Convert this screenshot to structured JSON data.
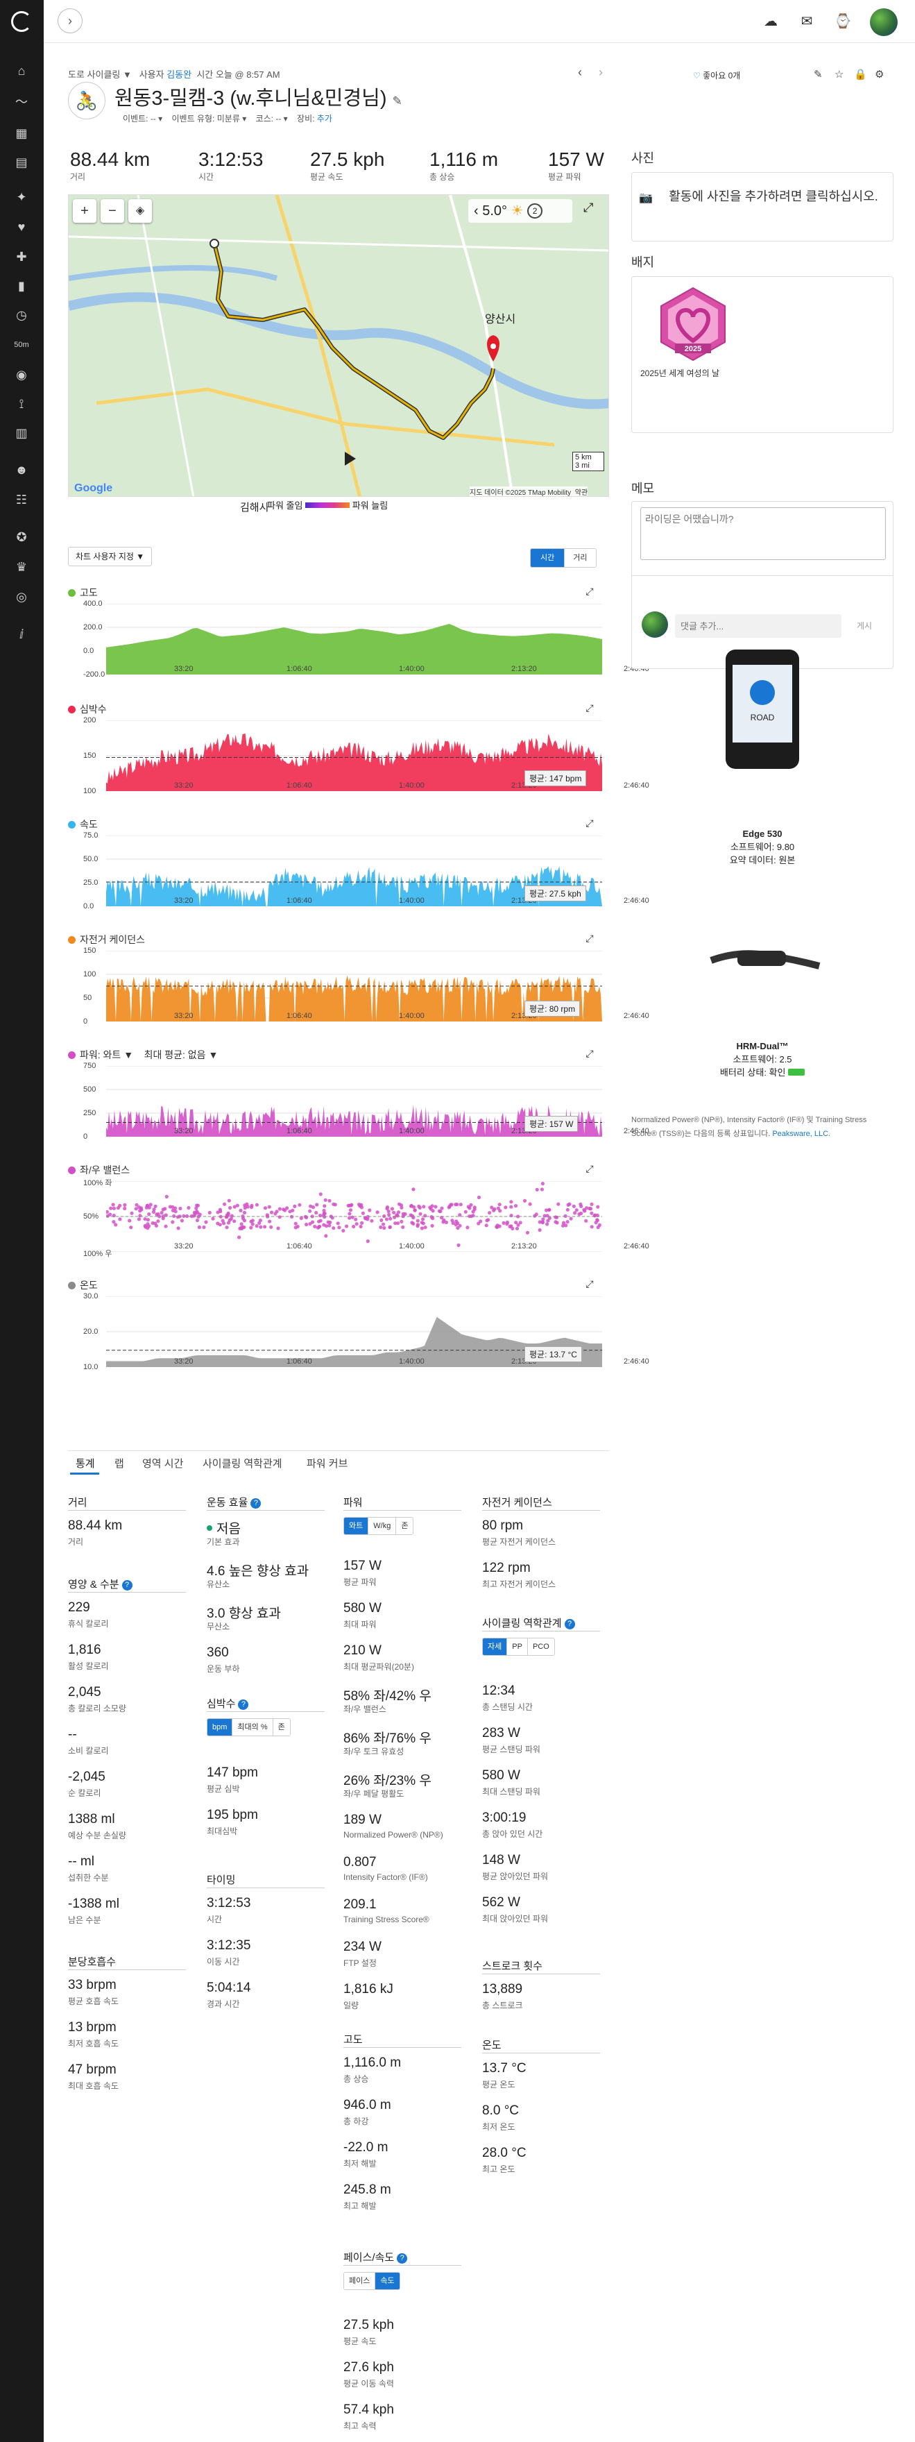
{
  "activity": {
    "type_label": "도로 사이클링 ▼",
    "user_prefix": "사용자",
    "user_name": "김동완",
    "time_info": "시간 오늘 @ 8:57 AM",
    "title": "원동3-밀캠-3 (w.후니님&민경님)",
    "event_label": "이벤트:",
    "event_value": "--",
    "event_type_label": "이벤트 유형:",
    "event_type_value": "미분류",
    "course_label": "코스:",
    "course_value": "--",
    "gear_label": "장비:",
    "gear_value": "추가",
    "likes": "좋아요 0개"
  },
  "summary": [
    {
      "value": "88.44 km",
      "label": "거리"
    },
    {
      "value": "3:12:53",
      "label": "시간"
    },
    {
      "value": "27.5 kph",
      "label": "평균 속도"
    },
    {
      "value": "1,116 m",
      "label": "총 상승"
    },
    {
      "value": "157 W",
      "label": "평균 파워"
    }
  ],
  "map": {
    "temp": "5.0°",
    "count": "2",
    "labels": {
      "yangsan": "양산시",
      "gimhae": "김해시"
    },
    "scale_km": "5 km",
    "scale_mi": "3 mi",
    "attribution": "지도 데이터 ©2025 TMap Mobility",
    "terms": "약관",
    "power_low": "파워 줄임",
    "power_high": "파워 늘림"
  },
  "chart_controls": {
    "custom": "차트 사용자 지정 ▼",
    "time": "시간",
    "distance": "거리"
  },
  "charts": {
    "elevation": {
      "title": "고도",
      "color": "#6cbf3a",
      "yticks": [
        "400.0",
        "200.0",
        "0.0",
        "-200.0"
      ],
      "values": [
        30,
        45,
        60,
        80,
        95,
        110,
        150,
        200,
        160,
        120,
        130,
        140,
        160,
        180,
        200,
        175,
        150,
        145,
        155,
        165,
        190,
        175,
        160,
        140,
        150,
        170,
        200,
        230,
        180,
        150,
        140,
        130,
        125,
        130,
        140,
        150,
        145,
        135,
        120,
        100
      ]
    },
    "heart": {
      "title": "심박수",
      "color": "#f0284d",
      "yticks": [
        "200",
        "150",
        "100"
      ],
      "avg": "평균: 147 bpm",
      "values": [
        110,
        120,
        130,
        140,
        145,
        150,
        148,
        152,
        160,
        170,
        180,
        175,
        165,
        160,
        150,
        145,
        148,
        150,
        155,
        160,
        158,
        150,
        145,
        150,
        160,
        165,
        170,
        168,
        160,
        150,
        148,
        152,
        160,
        165,
        170,
        175,
        168,
        160,
        150,
        145
      ]
    },
    "speed": {
      "title": "속도",
      "color": "#35b5ef",
      "yticks": [
        "75.0",
        "50.0",
        "25.0",
        "0.0"
      ],
      "avg": "평균: 27.5 kph",
      "values": [
        20,
        22,
        25,
        30,
        28,
        26,
        24,
        22,
        20,
        18,
        16,
        15,
        14,
        30,
        35,
        32,
        28,
        20,
        25,
        30,
        34,
        36,
        30,
        26,
        24,
        28,
        32,
        30,
        26,
        20,
        22,
        24,
        26,
        30,
        36,
        40,
        34,
        28,
        24,
        20
      ]
    },
    "cadence": {
      "title": "자전거 케이던스",
      "color": "#f08a1c",
      "yticks": [
        "150",
        "100",
        "50",
        "0"
      ],
      "avg": "평균: 80 rpm",
      "values": [
        80,
        82,
        85,
        84,
        83,
        81,
        80,
        79,
        78,
        80,
        82,
        84,
        86,
        85,
        83,
        80,
        78,
        82,
        84,
        86,
        85,
        83,
        80,
        78,
        79,
        81,
        83,
        85,
        84,
        82,
        80,
        78,
        80,
        82,
        84,
        86,
        85,
        83,
        80,
        78
      ]
    },
    "power": {
      "title": "파워: 와트 ▼",
      "title2": "최대 평균: 없음 ▼",
      "color": "#d34fc8",
      "yticks": [
        "750",
        "500",
        "250",
        "0"
      ],
      "avg": "평균: 157 W",
      "values": [
        150,
        160,
        180,
        200,
        220,
        210,
        190,
        170,
        160,
        150,
        140,
        160,
        180,
        200,
        230,
        250,
        220,
        200,
        180,
        160,
        150,
        170,
        190,
        210,
        230,
        220,
        200,
        180,
        160,
        150,
        140,
        160,
        180,
        200,
        220,
        210,
        190,
        170,
        150,
        140
      ]
    },
    "balance": {
      "title": "좌/우 밸런스",
      "color": "#d34fc8",
      "yticks": [
        "100% 좌",
        "50%",
        "100% 우"
      ]
    },
    "temperature": {
      "title": "온도",
      "color": "#8a8a8a",
      "yticks": [
        "30.0",
        "20.0",
        "10.0"
      ],
      "avg": "평균: 13.7 °C",
      "values": [
        10,
        10,
        10,
        10,
        11,
        11,
        11,
        12,
        12,
        12,
        12,
        12,
        11,
        11,
        11,
        11,
        11,
        11,
        12,
        12,
        12,
        12,
        13,
        13,
        14,
        15,
        25,
        22,
        19,
        18,
        17,
        18,
        17,
        16,
        16,
        17,
        18,
        17,
        16,
        16
      ]
    },
    "xticks": [
      "33:20",
      "1:06:40",
      "1:40:00",
      "2:13:20",
      "2:46:40"
    ]
  },
  "tabs": [
    "통계",
    "랩",
    "영역 시간",
    "사이클링 역학관계",
    "파워 커브"
  ],
  "col1": {
    "distance": {
      "head": "거리",
      "value": "88.44 km",
      "label": "거리"
    },
    "nutrition": {
      "head": "영양 & 수분",
      "items": [
        {
          "value": "229",
          "label": "휴식 칼로리"
        },
        {
          "value": "1,816",
          "label": "활성 칼로리"
        },
        {
          "value": "2,045",
          "label": "총 칼로리 소모량"
        },
        {
          "value": "--",
          "label": "소비 칼로리"
        },
        {
          "value": "-2,045",
          "label": "순 칼로리"
        },
        {
          "value": "1388 ml",
          "label": "예상 수분 손실량"
        },
        {
          "value": "-- ml",
          "label": "섭취한 수분"
        },
        {
          "value": "-1388 ml",
          "label": "남은 수분"
        }
      ]
    },
    "respiration": {
      "head": "분당호흡수",
      "items": [
        {
          "value": "33 brpm",
          "label": "평균 호흡 속도"
        },
        {
          "value": "13 brpm",
          "label": "최저 호흡 속도"
        },
        {
          "value": "47 brpm",
          "label": "최대 호흡 속도"
        }
      ]
    }
  },
  "col2": {
    "effect": {
      "head": "운동 효율",
      "items": [
        {
          "value": "저음",
          "label": "기본 효과"
        },
        {
          "value": "4.6 높은 향상 효과",
          "label": "유산소"
        },
        {
          "value": "3.0 향상 효과",
          "label": "무산소"
        },
        {
          "value": "360",
          "label": "운동 부하"
        }
      ]
    },
    "heart": {
      "head": "심박수",
      "seg": [
        "bpm",
        "최대의 %",
        "존"
      ],
      "items": [
        {
          "value": "147 bpm",
          "label": "평균 심박"
        },
        {
          "value": "195 bpm",
          "label": "최대심박"
        }
      ]
    },
    "timing": {
      "head": "타이밍",
      "items": [
        {
          "value": "3:12:53",
          "label": "시간"
        },
        {
          "value": "3:12:35",
          "label": "이동 시간"
        },
        {
          "value": "5:04:14",
          "label": "경과 시간"
        }
      ]
    }
  },
  "col3": {
    "power": {
      "head": "파워",
      "seg": [
        "와트",
        "W/kg",
        "존"
      ],
      "items": [
        {
          "value": "157 W",
          "label": "평균 파워"
        },
        {
          "value": "580 W",
          "label": "최대 파워"
        },
        {
          "value": "210 W",
          "label": "최대 평균파워(20분)"
        },
        {
          "value": "58% 좌/42% 우",
          "label": "좌/우 밸런스"
        },
        {
          "value": "86% 좌/76% 우",
          "label": "좌/우 토크 유효성"
        },
        {
          "value": "26% 좌/23% 우",
          "label": "좌/우 페달 평활도"
        },
        {
          "value": "189 W",
          "label": "Normalized Power® (NP®)"
        },
        {
          "value": "0.807",
          "label": "Intensity Factor® (IF®)"
        },
        {
          "value": "209.1",
          "label": "Training Stress Score®"
        },
        {
          "value": "234 W",
          "label": "FTP 설정"
        },
        {
          "value": "1,816 kJ",
          "label": "일량"
        }
      ]
    },
    "elevation": {
      "head": "고도",
      "items": [
        {
          "value": "1,116.0 m",
          "label": "총 상승"
        },
        {
          "value": "946.0 m",
          "label": "총 하강"
        },
        {
          "value": "-22.0 m",
          "label": "최저 해발"
        },
        {
          "value": "245.8 m",
          "label": "최고 해발"
        }
      ]
    },
    "pace": {
      "head": "페이스/속도",
      "seg": [
        "페이스",
        "속도"
      ],
      "items": [
        {
          "value": "27.5 kph",
          "label": "평균 속도"
        },
        {
          "value": "27.6 kph",
          "label": "평균 이동 속력"
        },
        {
          "value": "57.4 kph",
          "label": "최고 속력"
        }
      ]
    }
  },
  "col4": {
    "cadence": {
      "head": "자전거 케이던스",
      "items": [
        {
          "value": "80 rpm",
          "label": "평균 자전거 케이던스"
        },
        {
          "value": "122 rpm",
          "label": "최고 자전거 케이던스"
        }
      ]
    },
    "dynamics": {
      "head": "사이클링 역학관계",
      "seg": [
        "자세",
        "PP",
        "PCO"
      ],
      "items": [
        {
          "value": "12:34",
          "label": "총 스탠딩 시간"
        },
        {
          "value": "283 W",
          "label": "평균 스탠딩 파워"
        },
        {
          "value": "580 W",
          "label": "최대 스탠딩 파워"
        },
        {
          "value": "3:00:19",
          "label": "총 앉아 있던 시간"
        },
        {
          "value": "148 W",
          "label": "평균 앉아있던 파워"
        },
        {
          "value": "562 W",
          "label": "최대 앉아있던 파워"
        }
      ]
    },
    "strokes": {
      "head": "스트로크 횟수",
      "items": [
        {
          "value": "13,889",
          "label": "총 스트로크"
        }
      ]
    },
    "temperature": {
      "head": "온도",
      "items": [
        {
          "value": "13.7 °C",
          "label": "평균 온도"
        },
        {
          "value": "8.0 °C",
          "label": "최저 온도"
        },
        {
          "value": "28.0 °C",
          "label": "최고 온도"
        }
      ]
    }
  },
  "right": {
    "photos_title": "사진",
    "photos_text": "활동에 사진을 추가하려면 클릭하십시오.",
    "badges_title": "배지",
    "badge_year": "2025",
    "badge_name": "2025년 세계 여성의 날",
    "notes_title": "메모",
    "notes_placeholder": "라이딩은 어땠습니까?",
    "comment_placeholder": "댓글 추가...",
    "comment_post": "게시",
    "device1": {
      "name": "Edge 530",
      "sw": "소프트웨어: 9.80",
      "data": "요약 데이터: 원본",
      "screen_text": "ROAD"
    },
    "device2": {
      "name": "HRM-Dual™",
      "sw": "소프트웨어: 2.5",
      "battery": "배터리 상태: 확인"
    },
    "trademark": "Normalized Power® (NP®), Intensity Factor® (IF®) 및 Training Stress Score® (TSS®)는 다음의 등록 상표입니다.",
    "trademark_link": "Peaksware, LLC."
  }
}
